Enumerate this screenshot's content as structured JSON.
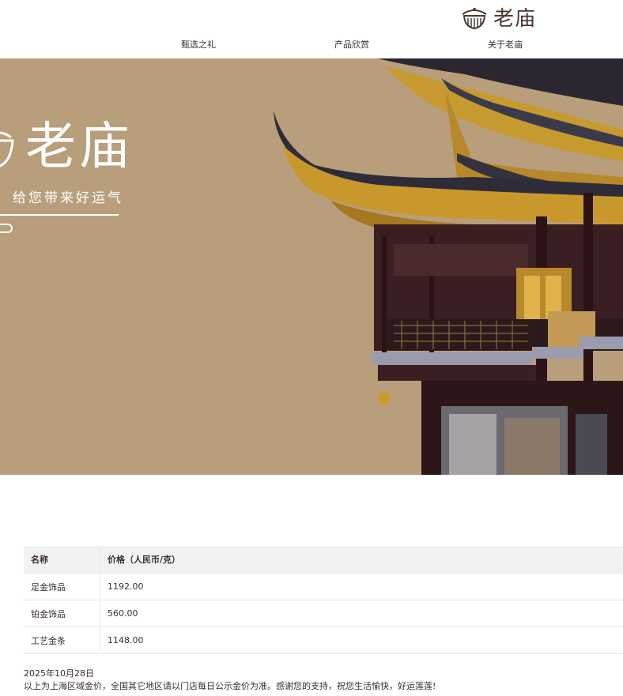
{
  "brand": {
    "name": "老庙",
    "icon": "temple-bowl-icon"
  },
  "nav": {
    "items": [
      "甄选之礼",
      "产品欣赏",
      "关于老庙"
    ]
  },
  "hero": {
    "title": "老庙",
    "subtitle": "给您带来好运气",
    "image": "temple-pagoda-photo",
    "bg_color": "#b99e7b"
  },
  "price_table": {
    "headers": [
      "名称",
      "价格（人民币/克）"
    ],
    "rows": [
      [
        "足金饰品",
        "1192.00"
      ],
      [
        "铂金饰品",
        "560.00"
      ],
      [
        "工艺金条",
        "1148.00"
      ]
    ]
  },
  "notes": {
    "date": "2025年10月28日",
    "disclaimer": "以上为上海区域金价，全国其它地区请以门店每日公示金价为准。感谢您的支持，祝您生活愉快，好运莲莲!"
  }
}
